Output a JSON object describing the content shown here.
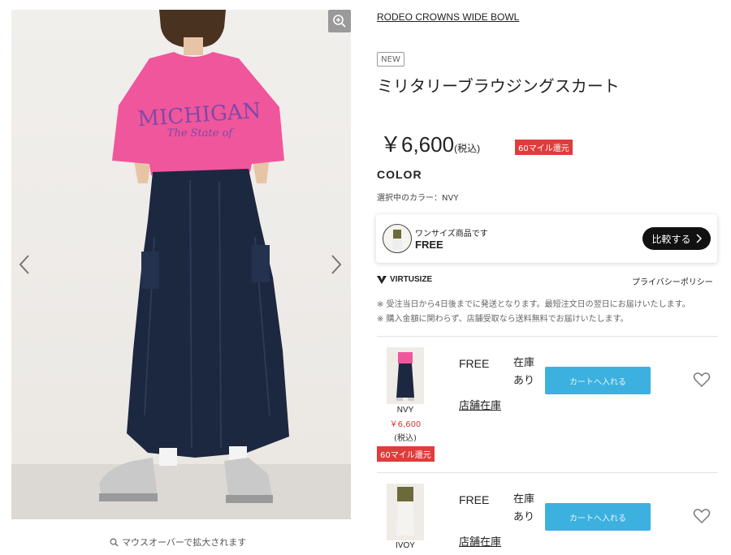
{
  "product": {
    "brand": "RODEO CROWNS WIDE BOWL",
    "badge": "NEW",
    "title": "ミリタリーブラウジングスカート",
    "price": "￥6,600",
    "tax_note": "(税込)",
    "miles_badge": "60マイル還元"
  },
  "gallery": {
    "zoom_hint": "マウスオーバーで拡大されます",
    "shirt_line1": "MICHIGAN",
    "shirt_line2": "The State of"
  },
  "color_section": {
    "heading": "COLOR",
    "selected": "選択中のカラー：NVY"
  },
  "virtusize": {
    "one_size_text": "ワンサイズ商品です",
    "size": "FREE",
    "compare_label": "比較する",
    "logo_text": "VIRTUSIZE",
    "privacy_link": "プライバシーポリシー"
  },
  "notes": [
    "※ 受注当日から4日後までに発送となります。最短注文日の翌日にお届けいたします。",
    "※ 購入金額に関わらず、店舗受取なら送料無料でお届けいたします。"
  ],
  "variants": [
    {
      "color": "NVY",
      "price": "￥6,600",
      "tax_note": "(税込)",
      "miles_badge": "60マイル還元",
      "size": "FREE",
      "stock_line1": "在庫",
      "stock_line2": "あり",
      "cart_label": "カートへ入れる",
      "store_link": "店舗在庫"
    },
    {
      "color": "IVOY",
      "size": "FREE",
      "stock_line1": "在庫",
      "stock_line2": "あり",
      "cart_label": "カートへ入れる",
      "store_link": "店舗在庫"
    }
  ],
  "colors": {
    "accent_red": "#e03c3c",
    "cart_blue": "#3cb1df",
    "shirt_pink": "#f0569c",
    "skirt_navy": "#1c2740"
  },
  "icons": [
    "zoom-in-icon",
    "chevron-left-icon",
    "chevron-right-icon",
    "virtusize-logo-icon",
    "heart-icon",
    "magnifier-icon"
  ]
}
